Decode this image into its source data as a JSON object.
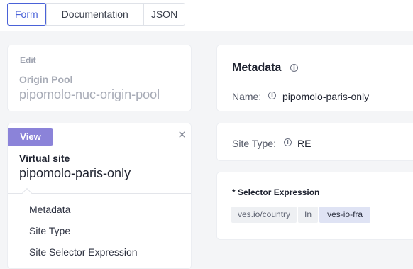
{
  "tabs": [
    {
      "label": "Form",
      "active": true
    },
    {
      "label": "Documentation",
      "active": false
    },
    {
      "label": "JSON",
      "active": false
    }
  ],
  "edit_panel": {
    "heading": "Edit",
    "object_type": "Origin Pool",
    "object_name": "pipomolo-nuc-origin-pool"
  },
  "view_panel": {
    "badge": "View",
    "object_type": "Virtual site",
    "object_name": "pipomolo-paris-only",
    "nav": [
      "Metadata",
      "Site Type",
      "Site Selector Expression"
    ]
  },
  "metadata": {
    "title": "Metadata",
    "name_label": "Name:",
    "name_value": "pipomolo-paris-only"
  },
  "site_type": {
    "label": "Site Type:",
    "value": "RE"
  },
  "selector": {
    "label": "* Selector Expression",
    "key": "ves.io/country",
    "operator": "In",
    "value": "ves-io-fra"
  },
  "colors": {
    "accent": "#4a62d8",
    "badge": "#8b83d9",
    "page_bg": "#f4f5f7"
  },
  "icons": {
    "close": "close-icon",
    "info": "info-icon"
  }
}
